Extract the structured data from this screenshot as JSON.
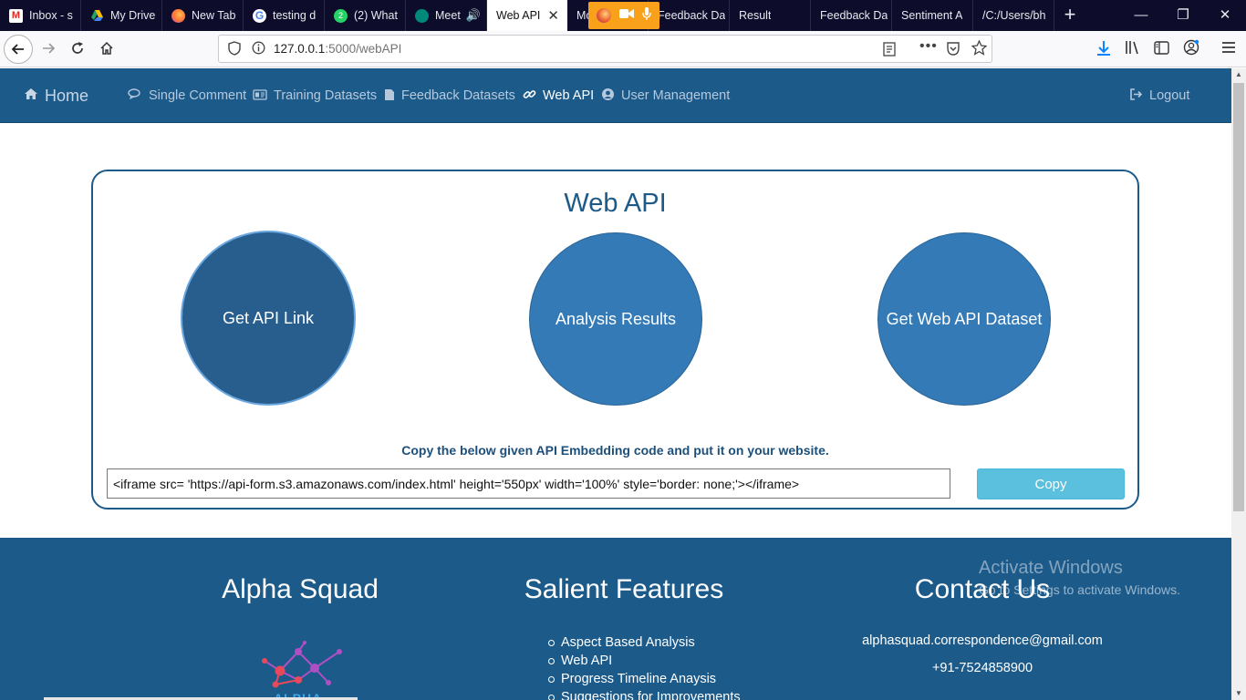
{
  "browser": {
    "tabs": [
      {
        "label": "Inbox - s",
        "icon": "gmail-icon",
        "color": "#d93025"
      },
      {
        "label": "My Drive",
        "icon": "google-drive-icon",
        "color": "#1fa463"
      },
      {
        "label": "New Tab",
        "icon": "firefox-icon",
        "color": "#ff7139"
      },
      {
        "label": "testing d",
        "icon": "google-icon",
        "color": "#4285f4"
      },
      {
        "label": "(2) What",
        "icon": "whatsapp-icon",
        "color": "#25d366"
      },
      {
        "label": "Meet",
        "icon": "google-meet-icon",
        "color": "#00897b"
      },
      {
        "label": "Web API",
        "icon": "",
        "color": ""
      },
      {
        "label": "Mo",
        "icon": "",
        "color": ""
      },
      {
        "label": "Feedback Da",
        "icon": "",
        "color": ""
      },
      {
        "label": "Result",
        "icon": "",
        "color": ""
      },
      {
        "label": "Feedback Da",
        "icon": "",
        "color": ""
      },
      {
        "label": "Sentiment A",
        "icon": "",
        "color": ""
      },
      {
        "label": "/C:/Users/bh",
        "icon": "",
        "color": ""
      }
    ],
    "active_tab_close": "✕",
    "new_tab": "+",
    "window_controls": {
      "minimize": "—",
      "restore": "❐",
      "close": "✕"
    },
    "url_host": "127.0.0.1",
    "url_rest": ":5000/webAPI"
  },
  "nav": {
    "home": "Home",
    "items": [
      {
        "label": "Single Comment",
        "icon": "comments-icon"
      },
      {
        "label": "Training Datasets",
        "icon": "id-card-icon"
      },
      {
        "label": "Feedback Datasets",
        "icon": "file-icon"
      },
      {
        "label": "Web API",
        "icon": "link-icon"
      },
      {
        "label": "User Management",
        "icon": "user-circle-icon"
      }
    ],
    "logout": "Logout"
  },
  "main": {
    "title": "Web API",
    "buttons": [
      "Get API Link",
      "Analysis Results",
      "Get Web API Dataset"
    ],
    "copy_hint": "Copy the below given API Embedding code and put it on your website.",
    "embed_code": "<iframe src= 'https://api-form.s3.amazonaws.com/index.html' height='550px' width='100%' style='border: none;'></iframe>",
    "copy_label": "Copy"
  },
  "footer": {
    "col1_title": "Alpha Squad",
    "logo_text": "ALPHA",
    "col2_title": "Salient Features",
    "features": [
      "Aspect Based Analysis",
      "Web API",
      "Progress Timeline Anaysis",
      "Suggestions for Improvements"
    ],
    "col3_title": "Contact Us",
    "email": "alphasquad.correspondence@gmail.com",
    "phone": "+91-7524858900"
  },
  "watermark": {
    "line1": "Activate Windows",
    "line2": "Go to Settings to activate Windows."
  },
  "colors": {
    "nav_bg": "#1c5a8a",
    "button_blue": "#337ab7",
    "copy_button": "#5bc0de"
  }
}
